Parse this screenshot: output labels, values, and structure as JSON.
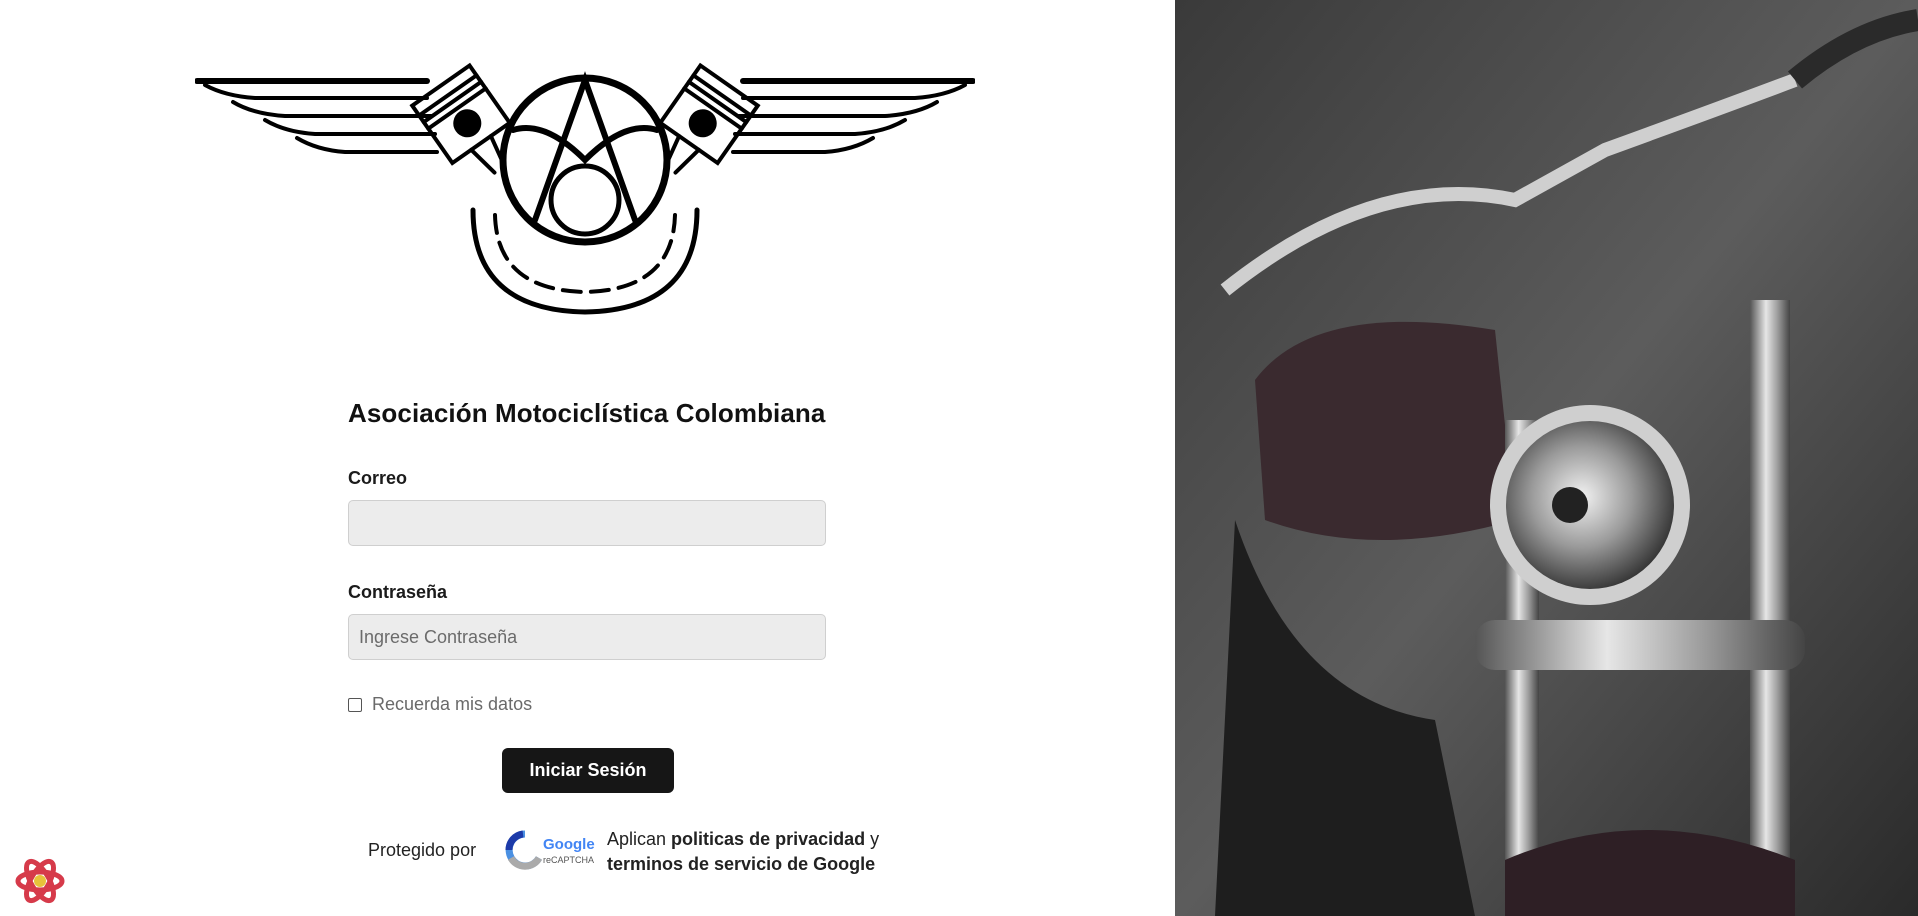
{
  "brand": {
    "title": "Asociación Motociclística Colombiana",
    "logo_icon": "ama-winged-piston-logo"
  },
  "form": {
    "email": {
      "label": "Correo",
      "value": "",
      "placeholder": ""
    },
    "password": {
      "label": "Contraseña",
      "value": "",
      "placeholder": "Ingrese Contraseña"
    },
    "remember": {
      "label": "Recuerda mis datos",
      "checked": false
    },
    "submit_label": "Iniciar Sesión"
  },
  "recaptcha": {
    "protected_by": "Protegido por",
    "badge_word": "Google",
    "badge_sub": "reCAPTCHA",
    "policy_prefix": "Aplican ",
    "privacy_link": "politicas de privacidad",
    "connector": " y",
    "terms_link": "terminos de servicio de Google"
  },
  "hero": {
    "image_icon": "motorcycle-photo"
  },
  "dev_badge": {
    "icon": "react-icon",
    "color": "#d63a4a"
  }
}
